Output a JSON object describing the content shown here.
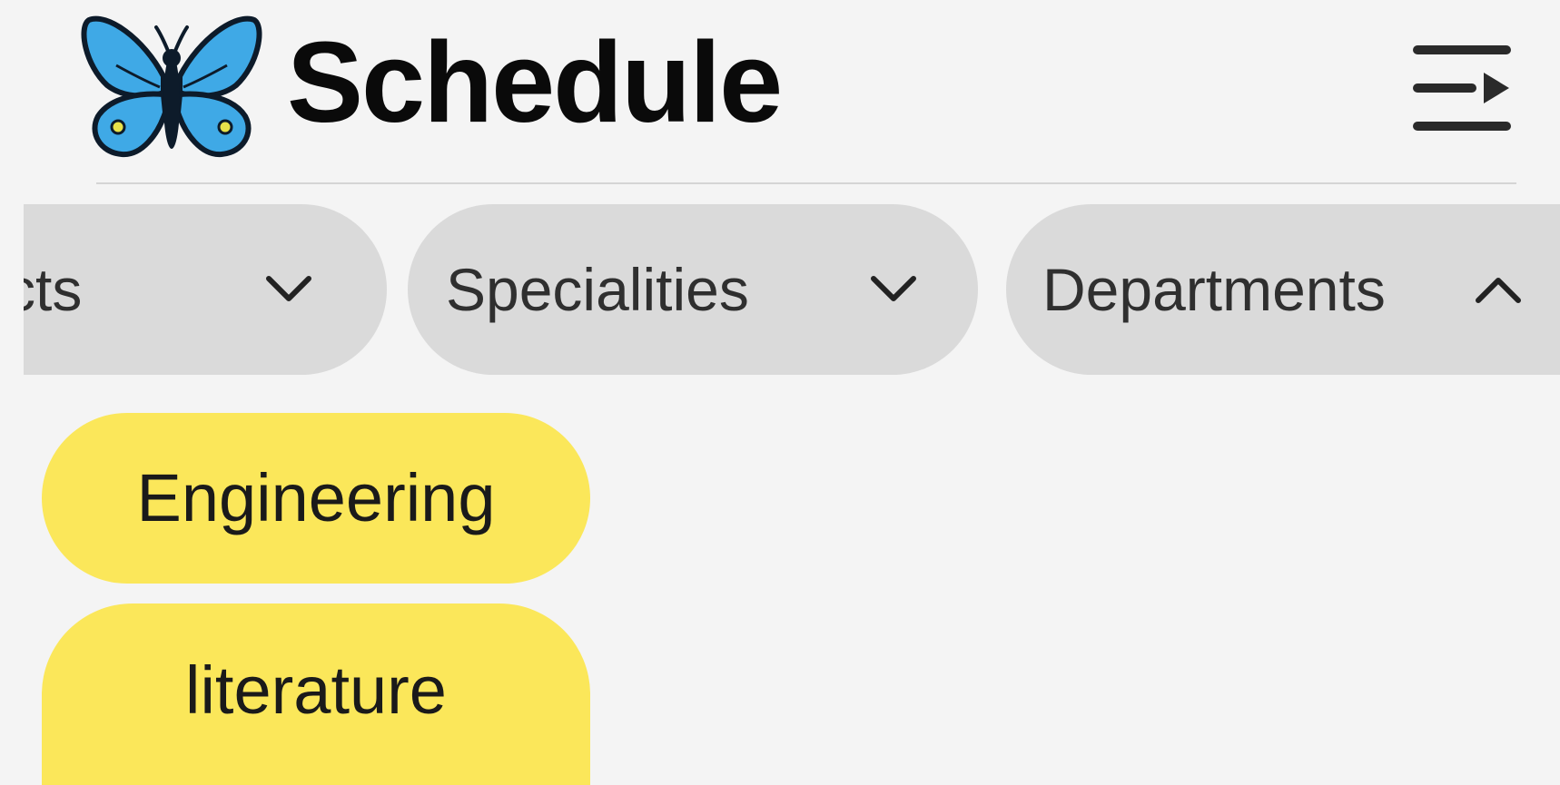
{
  "header": {
    "title": "Schedule",
    "logo_icon": "butterfly-icon",
    "menu_icon": "menu-collapse-icon"
  },
  "filters": [
    {
      "label": "cts",
      "icon": "chevron-down-icon",
      "expanded": false
    },
    {
      "label": "Specialities",
      "icon": "chevron-down-icon",
      "expanded": false
    },
    {
      "label": "Departments",
      "icon": "chevron-up-icon",
      "expanded": true
    }
  ],
  "departments_options": [
    {
      "label": "Engineering"
    },
    {
      "label": "literature"
    }
  ],
  "colors": {
    "background": "#f4f4f4",
    "chip": "#dadada",
    "option_chip": "#fbe75a",
    "butterfly_wing": "#3fa9e6",
    "butterfly_spot": "#e8e24a",
    "text": "#111111"
  }
}
